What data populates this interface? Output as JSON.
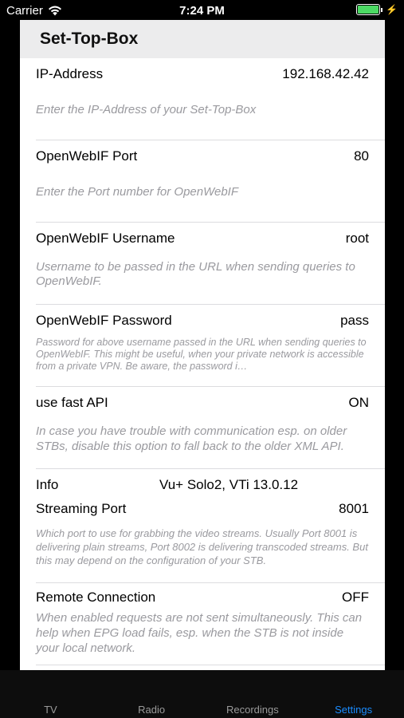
{
  "status_bar": {
    "carrier": "Carrier",
    "time": "7:24 PM"
  },
  "header": {
    "title": "Set-Top-Box"
  },
  "rows": [
    {
      "label": "IP-Address",
      "value": "192.168.42.42",
      "description": "Enter the IP-Address of your Set-Top-Box"
    },
    {
      "label": "OpenWebIF Port",
      "value": "80",
      "description": "Enter the Port number for OpenWebIF"
    },
    {
      "label": "OpenWebIF Username",
      "value": "root",
      "description": "Username to be passed in the URL when sending queries to OpenWebIF."
    },
    {
      "label": "OpenWebIF Password",
      "value": "pass",
      "description": "Password for above username passed in the URL when sending queries to OpenWebIF. This might be useful, when your private network is accessible from a private VPN. Be aware, the password i…"
    },
    {
      "label": "use fast API",
      "value": "ON",
      "description": "In case you have trouble with communication esp. on older STBs, disable this option to fall back to the older XML API."
    },
    {
      "label": "Info",
      "value": "Vu+ Solo2, VTi 13.0.12",
      "description": ""
    },
    {
      "label": "Streaming Port",
      "value": "8001",
      "description": "Which port to use for grabbing the video streams. Usually Port 8001 is delivering plain streams, Port 8002 is delivering transcoded streams. But this may depend on the configuration of your STB."
    },
    {
      "label": "Remote Connection",
      "value": "OFF",
      "description": "When enabled requests are not sent simultaneously. This can help when EPG load fails, esp. when the STB is not inside your local network."
    }
  ],
  "tabbar": {
    "tabs": [
      {
        "label": "TV",
        "active": false
      },
      {
        "label": "Radio",
        "active": false
      },
      {
        "label": "Recordings",
        "active": false
      },
      {
        "label": "Settings",
        "active": true
      }
    ]
  },
  "colors": {
    "accent": "#1a8cff",
    "battery": "#4cd964",
    "description": "#9a9a9f"
  }
}
